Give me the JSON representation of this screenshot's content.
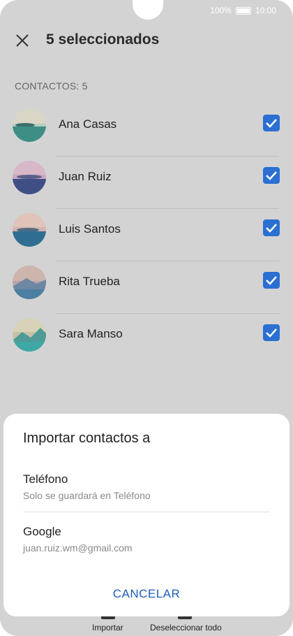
{
  "status_bar": {
    "battery": "100%",
    "time": "10:00"
  },
  "header": {
    "title": "5 seleccionados"
  },
  "section": {
    "label": "CONTACTOS: 5"
  },
  "contacts": [
    {
      "name": "Ana Casas",
      "checked": true
    },
    {
      "name": "Juan Ruiz",
      "checked": true
    },
    {
      "name": "Luis Santos",
      "checked": true
    },
    {
      "name": "Rita Trueba",
      "checked": true
    },
    {
      "name": "Sara Manso",
      "checked": true
    }
  ],
  "bottom_bar": {
    "import_label": "Importar",
    "deselect_label": "Deseleccionar todo"
  },
  "dialog": {
    "title": "Importar contactos a",
    "options": [
      {
        "title": "Teléfono",
        "subtitle": "Solo se guardará en Teléfono"
      },
      {
        "title": "Google",
        "subtitle": "juan.ruiz.wm@gmail.com"
      }
    ],
    "cancel_label": "CANCELAR"
  },
  "colors": {
    "accent": "#2b6fd3",
    "link": "#1e5eb8",
    "dim_background": "#d3d3d3"
  }
}
